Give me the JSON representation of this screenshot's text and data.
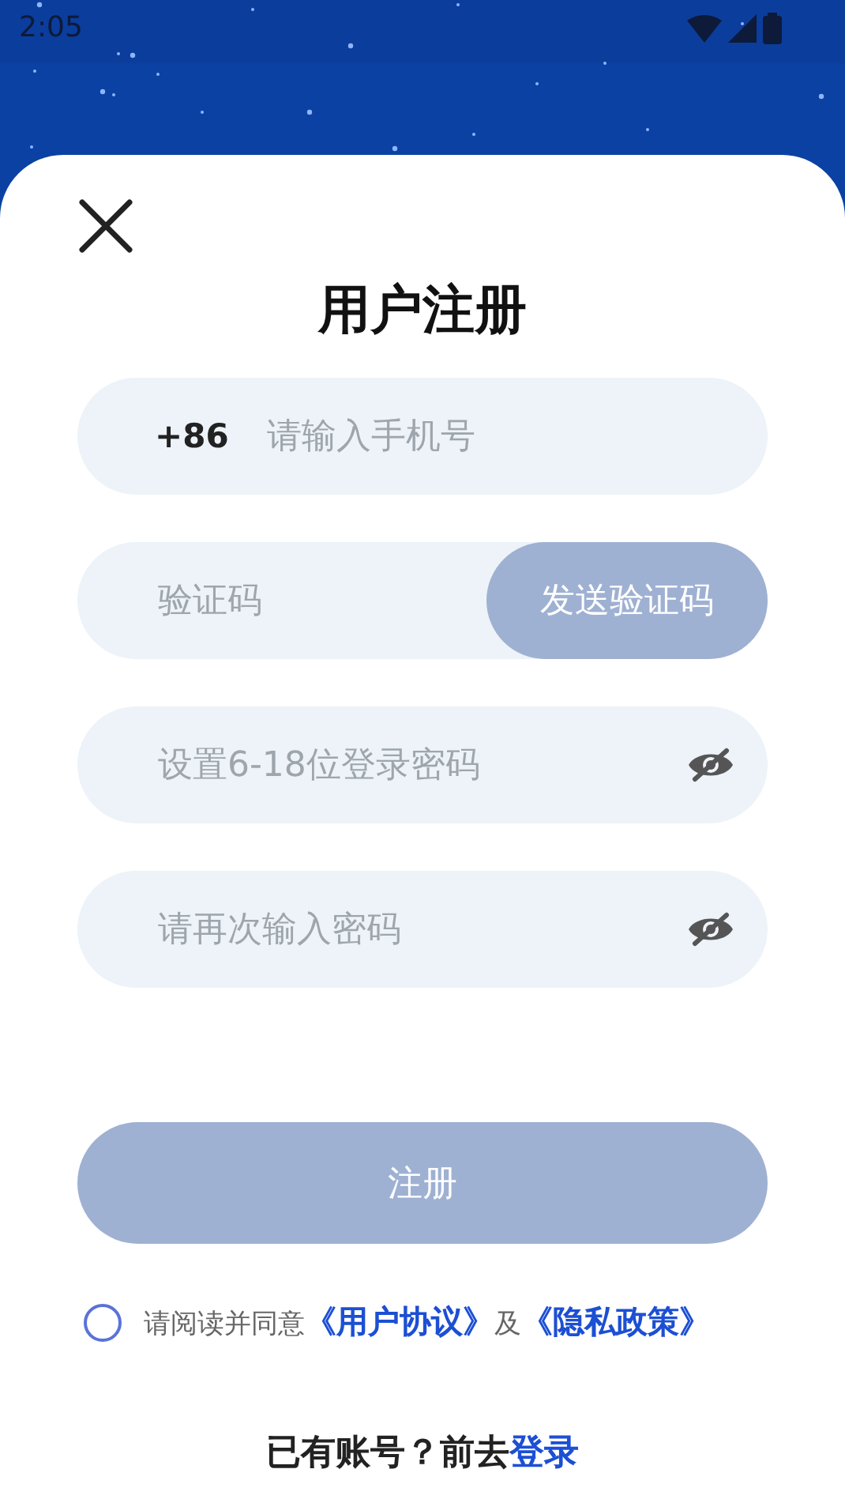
{
  "status_bar": {
    "time": "2:05"
  },
  "title": "用户注册",
  "phone": {
    "prefix": "+86",
    "placeholder": "请输入手机号"
  },
  "code": {
    "placeholder": "验证码",
    "button": "发送验证码",
    "button_disabled": true
  },
  "passwords": [
    {
      "placeholder": "设置6-18位登录密码",
      "visible": false
    },
    {
      "placeholder": "请再次输入密码",
      "visible": false
    }
  ],
  "submit": {
    "label": "注册",
    "disabled": true
  },
  "agreement": {
    "checked": false,
    "text": "请阅读并同意",
    "link_1": "《用户协议》",
    "joiner": "及",
    "link_2": "《隐私政策》"
  },
  "footer": {
    "text": "已有账号？前去",
    "link": "登录"
  }
}
